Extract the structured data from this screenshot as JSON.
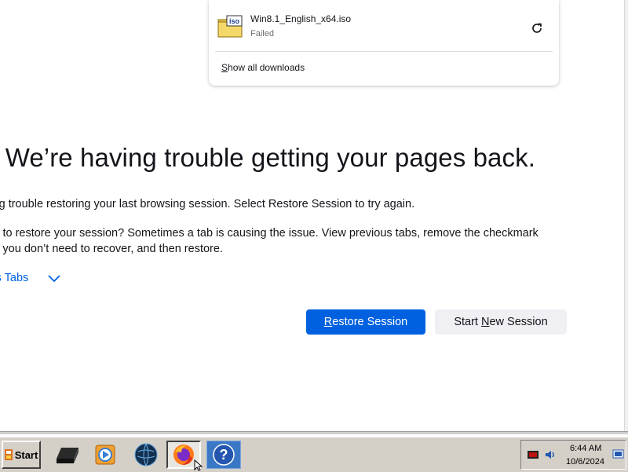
{
  "downloads": {
    "item": {
      "filename": "Win8.1_English_x64.iso",
      "status": "Failed",
      "icon": "iso-file-icon",
      "retry_icon": "retry-icon"
    },
    "show_all_prefix": "S",
    "show_all_rest": "how all downloads"
  },
  "error_page": {
    "title": "y. We’re having trouble getting your pages back.",
    "para1": "aving trouble restoring your last browsing session. Select Restore Session to try again.",
    "para2_line1": "able to restore your session? Sometimes a tab is causing the issue. View previous tabs, remove the checkmark",
    "para2_line2": " tabs you don’t need to recover, and then restore.",
    "view_tabs_label": "evious Tabs",
    "restore_btn_prefix": "R",
    "restore_btn_rest": "estore Session",
    "new_session_prefix": "Start ",
    "new_session_ul": "N",
    "new_session_rest": "ew Session"
  },
  "taskbar": {
    "start_label": "Start",
    "apps": [
      "terminal-icon",
      "media-player-icon",
      "globe-icon",
      "firefox-icon",
      "help-icon"
    ],
    "clock_time": "6:44 AM",
    "clock_date": "10/6/2024"
  },
  "colors": {
    "accent": "#0061e0",
    "text": "#15141a",
    "taskbar": "#d4d0c8"
  }
}
